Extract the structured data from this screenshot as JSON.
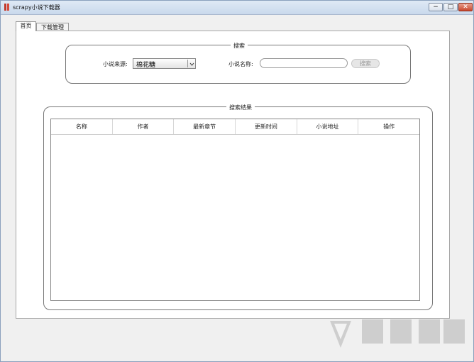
{
  "window": {
    "title": "scrapy小说下载器",
    "controls": {
      "minimize": "−",
      "maximize": "□",
      "close": "✕"
    }
  },
  "tabs": [
    {
      "label": "首页",
      "selected": true
    },
    {
      "label": "下载管理",
      "selected": false
    }
  ],
  "search": {
    "legend": "搜索",
    "source_label": "小说来源:",
    "source_value": "棉花糖",
    "name_label": "小说名称:",
    "name_value": "",
    "button_label": "搜索"
  },
  "results": {
    "legend": "搜索结果",
    "columns": [
      "名称",
      "作者",
      "最新章节",
      "更新时间",
      "小说地址",
      "操作"
    ],
    "rows": []
  },
  "colors": {
    "title_bar": "#c9d9ec",
    "close_button": "#c9462c",
    "panel": "#ffffff",
    "disabled_button": "#e6e6e6"
  }
}
